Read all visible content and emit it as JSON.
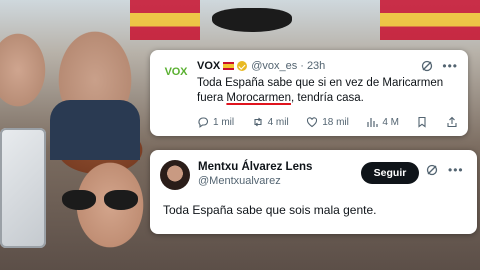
{
  "tweet1": {
    "logo_text": "VOX",
    "display_name": "VOX",
    "handle": "@vox_es",
    "separator": "·",
    "time": "23h",
    "text_before": "Toda España sabe que si en vez de Maricarmen fuera ",
    "text_highlight": "Morocarmen",
    "text_after": ", tendría casa.",
    "replies": "1 mil",
    "reposts": "4 mil",
    "likes": "18 mil",
    "views": "4 M",
    "icons": [
      "grok-icon",
      "more-icon",
      "reply-icon",
      "repost-icon",
      "like-icon",
      "views-icon",
      "bookmark-icon",
      "share-icon"
    ]
  },
  "tweet2": {
    "display_name": "Mentxu Álvarez Lens",
    "handle": "@Mentxualvarez",
    "follow_label": "Seguir",
    "text": "Toda España sabe que sois mala gente.",
    "icons": [
      "grok-icon",
      "more-icon"
    ]
  },
  "colors": {
    "vox_green": "#5ab031",
    "underline_red": "#e0141e",
    "button_dark": "#0f1419",
    "secondary_text": "#536471"
  }
}
